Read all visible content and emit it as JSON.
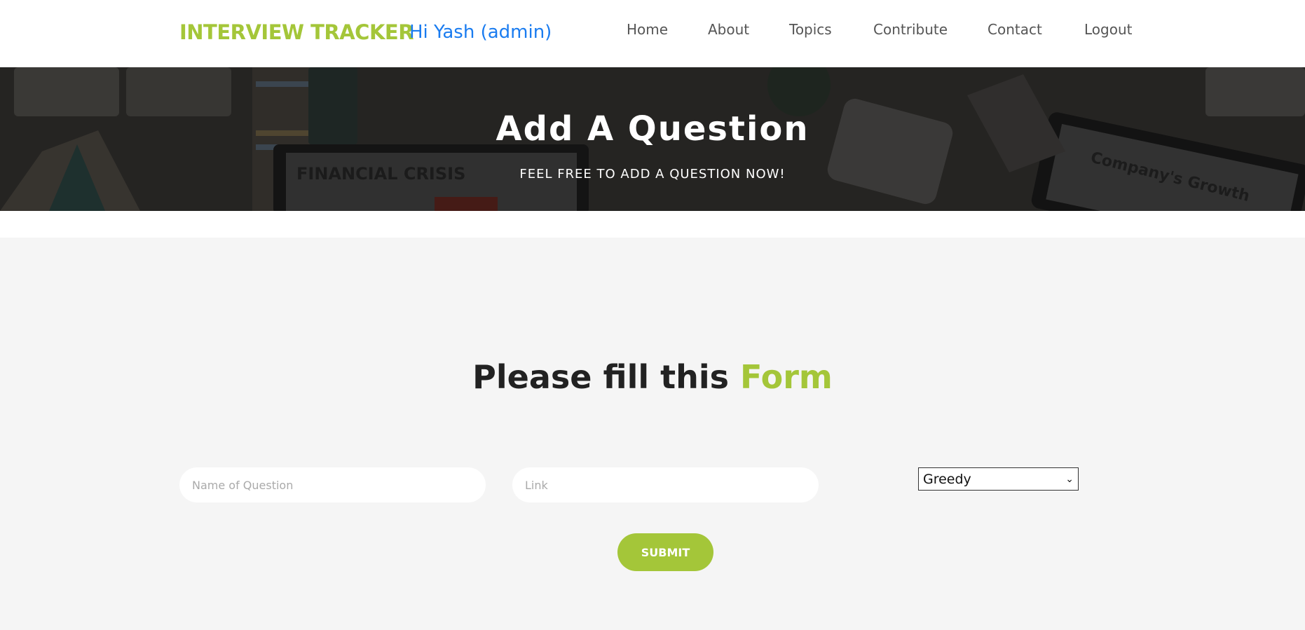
{
  "navbar": {
    "brand": "INTERVIEW TRACKER",
    "greeting": "Hi Yash (admin)",
    "links": [
      "Home",
      "About",
      "Topics",
      "Contribute",
      "Contact",
      "Logout"
    ]
  },
  "hero": {
    "title": "Add A Question",
    "subtitle": "FEEL FREE TO ADD A QUESTION NOW!",
    "background_texts": [
      "FINANCIAL CRISIS",
      "Company's Growth"
    ]
  },
  "form": {
    "heading_main": "Please fill this",
    "heading_accent": "Form",
    "name_placeholder": "Name of Question",
    "link_placeholder": "Link",
    "topic_selected": "Greedy",
    "submit_label": "SUBMIT"
  },
  "colors": {
    "accent_green": "#a4c639",
    "greeting_blue": "#1a7cf0"
  }
}
